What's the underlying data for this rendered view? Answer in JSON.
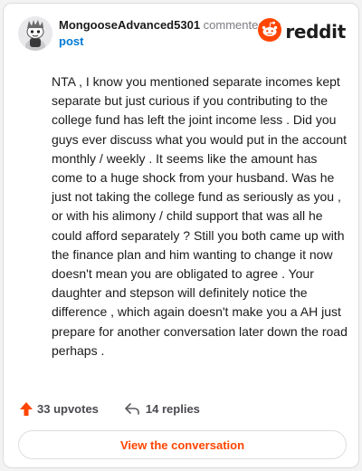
{
  "comment": {
    "username": "MongooseAdvanced5301",
    "action_text": "commented on",
    "post_link": "post",
    "avatar_icon": "reddit-snoo-avatar-icon",
    "body": "NTA , I know you mentioned separate incomes kept separate but just curious if you contributing to the college fund has left the joint income less . Did you guys ever discuss what you would put in the account monthly / weekly . It seems like the amount has come to a huge shock from your husband. Was he just not taking the college fund as seriously as you , or with his alimony / child support that was all he could afford separately ? Still you both came up with the finance plan and him wanting to change it now doesn't mean you are obligated to agree . Your daughter and stepson will definitely notice the difference , which again doesn't make you a AH just prepare for another conversation later down the road perhaps ."
  },
  "brand": {
    "wordmark": "reddit",
    "icon": "reddit-logo-icon",
    "accent_color": "#ff4500"
  },
  "actions": {
    "upvotes_label": "33 upvotes",
    "upvote_icon": "upvote-arrow-icon",
    "replies_label": "14 replies",
    "reply_icon": "reply-arrow-icon"
  },
  "cta": {
    "label": "View the conversation"
  }
}
